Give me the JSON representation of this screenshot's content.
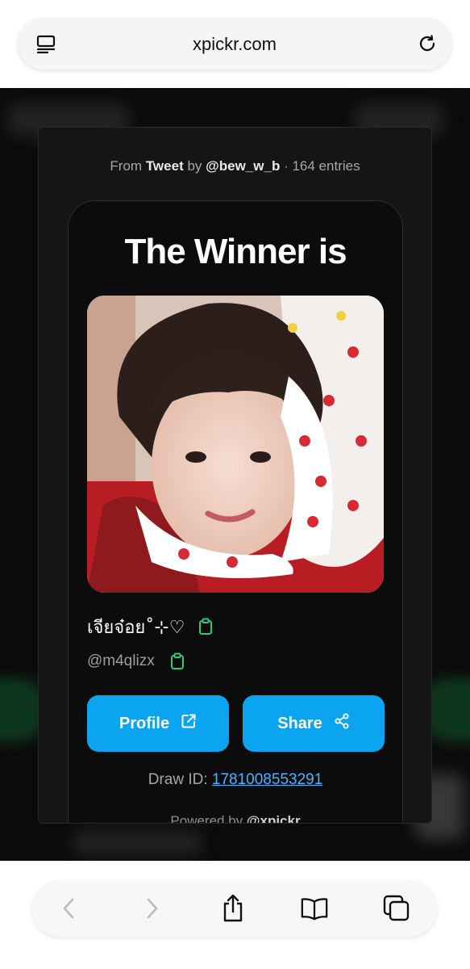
{
  "browser": {
    "url": "xpickr.com"
  },
  "modal": {
    "from_prefix": "From",
    "from_source": "Tweet",
    "from_by": "by",
    "from_user": "@bew_w_b",
    "from_separator": "·",
    "entries": "164 entries"
  },
  "card": {
    "headline": "The Winner is",
    "winner_name": "เจียจ๋อย˚⊹♡",
    "winner_handle": "@m4qlizx",
    "profile_label": "Profile",
    "share_label": "Share",
    "draw_id_label": "Draw ID:",
    "draw_id_value": "1781008553291",
    "powered_prefix": "Powered by",
    "powered_brand": "@xpickr"
  },
  "colors": {
    "accent": "#0aa4f0",
    "clipboard_icon": "#2ecc71",
    "background": "#0b0b0c"
  },
  "icons": [
    "tab-overview-icon",
    "reload-icon",
    "external-link-icon",
    "share-nodes-icon",
    "clipboard-icon",
    "back-arrow-icon",
    "forward-arrow-icon",
    "share-sheet-icon",
    "bookmarks-icon",
    "tabs-icon"
  ]
}
